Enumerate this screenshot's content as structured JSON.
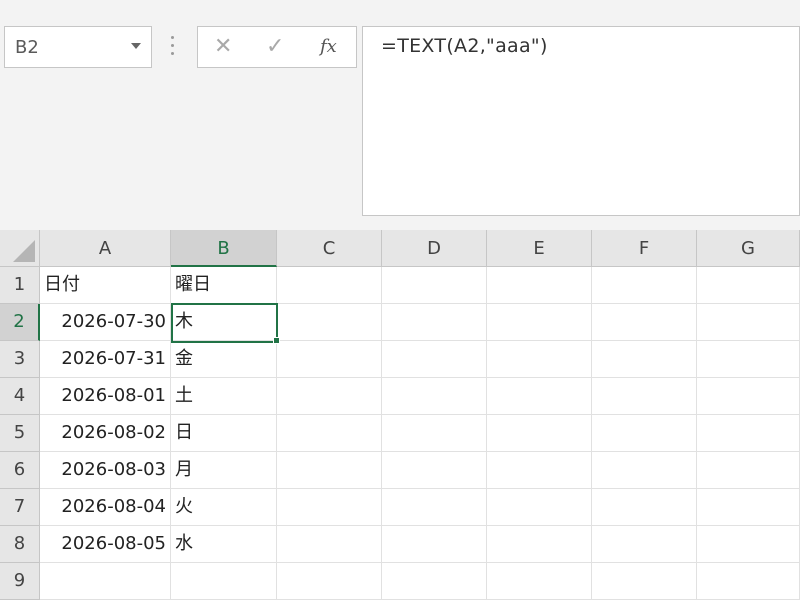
{
  "name_box": {
    "value": "B2"
  },
  "formula_bar": {
    "cancel_symbol": "✕",
    "enter_symbol": "✓",
    "fx_label": "fx",
    "formula": "=TEXT(A2,\"aaa\")"
  },
  "columns": [
    "A",
    "B",
    "C",
    "D",
    "E",
    "F",
    "G"
  ],
  "selected_column": "B",
  "selected_row": 2,
  "rows": [
    {
      "row": "1",
      "A": "日付",
      "B": "曜日"
    },
    {
      "row": "2",
      "A": "2026-07-30",
      "B": "木"
    },
    {
      "row": "3",
      "A": "2026-07-31",
      "B": "金"
    },
    {
      "row": "4",
      "A": "2026-08-01",
      "B": "土"
    },
    {
      "row": "5",
      "A": "2026-08-02",
      "B": "日"
    },
    {
      "row": "6",
      "A": "2026-08-03",
      "B": "月"
    },
    {
      "row": "7",
      "A": "2026-08-04",
      "B": "火"
    },
    {
      "row": "8",
      "A": "2026-08-05",
      "B": "水"
    },
    {
      "row": "9",
      "A": "",
      "B": ""
    }
  ],
  "colors": {
    "accent": "#217346",
    "header_bg": "#e6e6e6",
    "grid_line": "#e1e1e1"
  }
}
